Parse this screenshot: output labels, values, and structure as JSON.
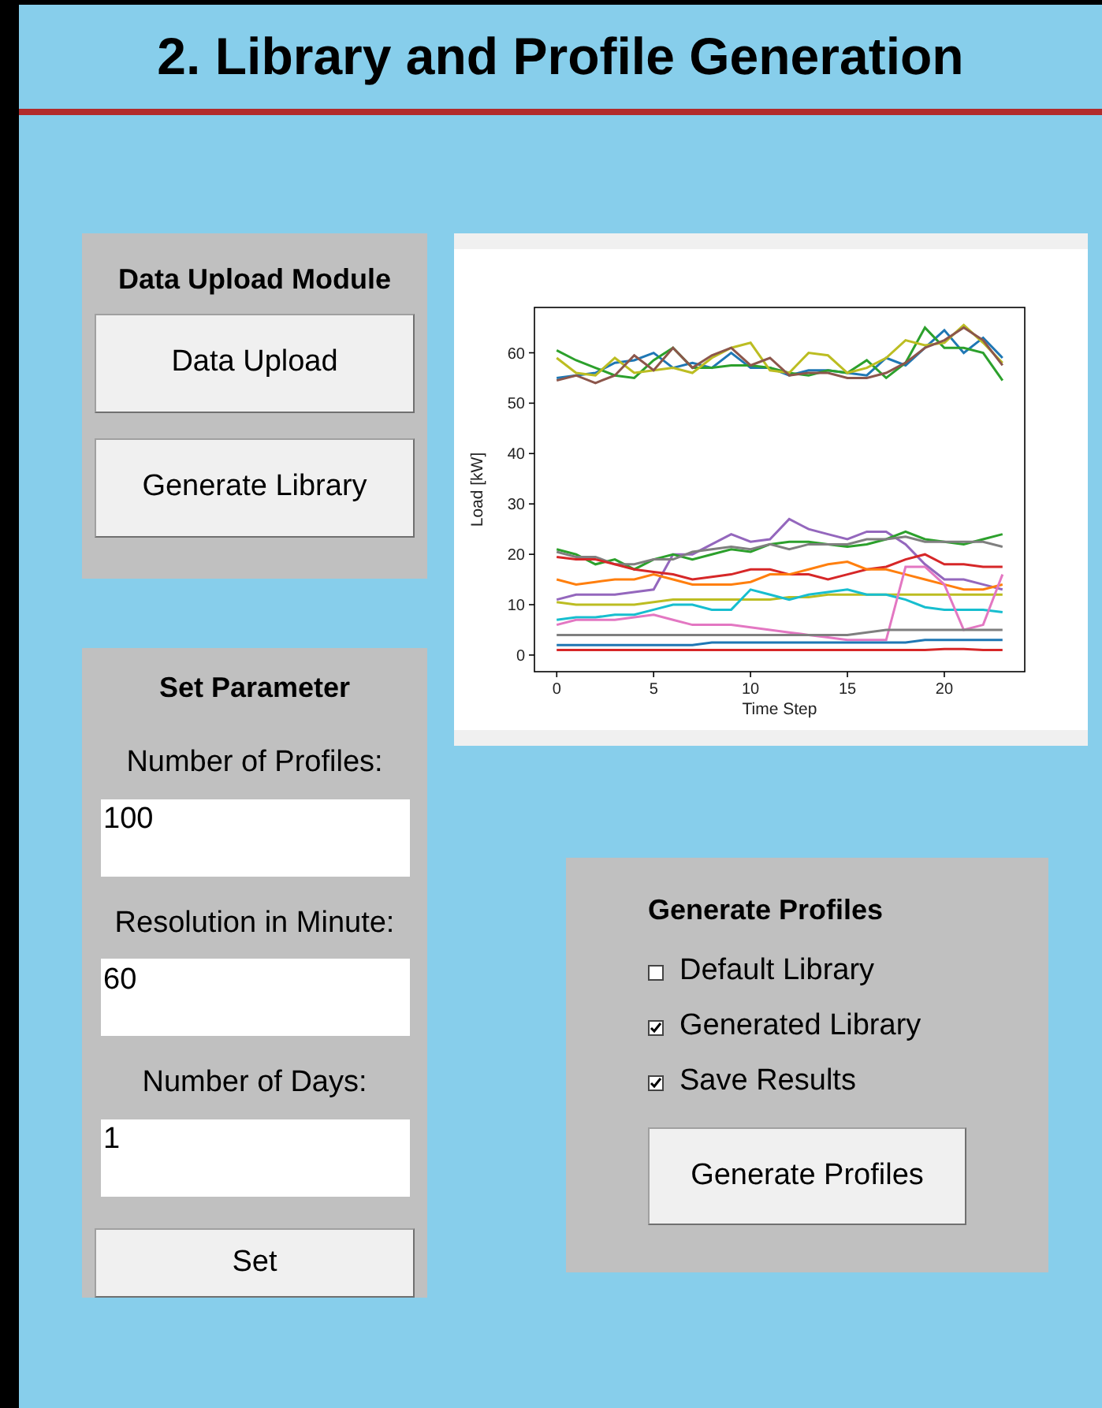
{
  "window": {
    "title": "2. Library and Profile Generation"
  },
  "upload_panel": {
    "title": "Data Upload Module",
    "buttons": [
      "Data Upload",
      "Generate Library"
    ]
  },
  "parameter_panel": {
    "title": "Set Parameter",
    "fields": [
      {
        "label": "Number of Profiles:",
        "value": "100"
      },
      {
        "label": "Resolution in Minute:",
        "value": "60"
      },
      {
        "label": "Number of Days:",
        "value": "1"
      }
    ],
    "button": "Set"
  },
  "chart": {
    "chart_data": {
      "type": "line",
      "xlabel": "Time Step",
      "ylabel": "Load [kW]",
      "xlim": [
        -1.15,
        24.15
      ],
      "ylim": [
        -3.3,
        69
      ],
      "xticks": [
        0,
        5,
        10,
        15,
        20
      ],
      "yticks": [
        0,
        10,
        20,
        30,
        40,
        50,
        60
      ],
      "x": [
        0,
        1,
        2,
        3,
        4,
        5,
        6,
        7,
        8,
        9,
        10,
        11,
        12,
        13,
        14,
        15,
        16,
        17,
        18,
        19,
        20,
        21,
        22,
        23
      ],
      "series": [
        {
          "color": "#1f77b4",
          "values": [
            55,
            55.5,
            56,
            58,
            58.5,
            60,
            57,
            58,
            57,
            60,
            57,
            57,
            55.5,
            56.5,
            56.5,
            56,
            55.5,
            59,
            57.5,
            61,
            64.5,
            60,
            63,
            59
          ]
        },
        {
          "color": "#2ca02c",
          "values": [
            60.5,
            58.5,
            57,
            55.5,
            55,
            58.5,
            61,
            57,
            57,
            57.5,
            57.5,
            57,
            56,
            55.5,
            56.5,
            56,
            58.5,
            55,
            58,
            65,
            61,
            61,
            60,
            54.5
          ]
        },
        {
          "color": "#bcbd22",
          "values": [
            59,
            56,
            55.5,
            59,
            56,
            56.5,
            57,
            56,
            59,
            61,
            62,
            56.5,
            56,
            60,
            59.5,
            56,
            57,
            59,
            62.5,
            61.5,
            62,
            65.5,
            62,
            58
          ]
        },
        {
          "color": "#8c564b",
          "values": [
            54.5,
            55.5,
            54,
            55.5,
            59.5,
            56.5,
            61,
            57,
            59.5,
            61,
            57.5,
            59,
            55.5,
            56,
            56,
            55,
            55,
            56,
            58,
            61,
            62.5,
            65,
            62.5,
            57.5
          ]
        },
        {
          "color": "#9467bd",
          "values": [
            11,
            12,
            12,
            12,
            12.5,
            13,
            20,
            20,
            22,
            24,
            22.5,
            23,
            27,
            25,
            24,
            23,
            24.5,
            24.5,
            22,
            18,
            15,
            15,
            14,
            13
          ]
        },
        {
          "color": "#2ca02c",
          "values": [
            21,
            20,
            18,
            19,
            17,
            19,
            20,
            19,
            20,
            21,
            20.5,
            22,
            22.5,
            22.5,
            22,
            21.5,
            22,
            23,
            24.5,
            23,
            22.5,
            22,
            23,
            24
          ]
        },
        {
          "color": "#7f7f7f",
          "values": [
            20.5,
            19.5,
            19.5,
            18,
            18,
            19,
            19,
            20.5,
            21,
            21.5,
            21,
            22,
            21,
            22,
            22,
            22,
            23,
            23,
            23.5,
            22.5,
            22.5,
            22.5,
            22.5,
            21.5
          ]
        },
        {
          "color": "#d62728",
          "values": [
            19.5,
            19,
            19,
            18,
            17,
            16.5,
            16,
            15,
            15.5,
            16,
            17,
            17,
            16,
            16,
            15,
            16,
            17,
            17.5,
            19,
            20,
            18,
            18,
            17.5,
            17.5
          ]
        },
        {
          "color": "#ff7f0e",
          "values": [
            15,
            14,
            14.5,
            15,
            15,
            16,
            15,
            14,
            14,
            14,
            14.5,
            16,
            16,
            17,
            18,
            18.5,
            17,
            17,
            16,
            15,
            14,
            13,
            13,
            14
          ]
        },
        {
          "color": "#bcbd22",
          "values": [
            10.5,
            10,
            10,
            10,
            10,
            10.5,
            11,
            11,
            11,
            11,
            11,
            11,
            11.5,
            11.5,
            12,
            12,
            12,
            12,
            12,
            12,
            12,
            12,
            12,
            12
          ]
        },
        {
          "color": "#17becf",
          "values": [
            7,
            7.5,
            7.5,
            8,
            8,
            9,
            10,
            10,
            9,
            9,
            13,
            12,
            11,
            12,
            12.5,
            13,
            12,
            12,
            11,
            9.5,
            9,
            9,
            9,
            8.5
          ]
        },
        {
          "color": "#e377c2",
          "values": [
            6,
            7,
            7,
            7,
            7.5,
            8,
            7,
            6,
            6,
            6,
            5.5,
            5,
            4.5,
            4,
            3.5,
            3,
            3,
            3,
            17.5,
            17.5,
            14,
            5,
            6,
            16
          ]
        },
        {
          "color": "#7f7f7f",
          "values": [
            4,
            4,
            4,
            4,
            4,
            4,
            4,
            4,
            4,
            4,
            4,
            4,
            4,
            4,
            4,
            4,
            4.5,
            5,
            5,
            5,
            5,
            5,
            5,
            5
          ]
        },
        {
          "color": "#1f77b4",
          "values": [
            2,
            2,
            2,
            2,
            2,
            2,
            2,
            2,
            2.5,
            2.5,
            2.5,
            2.5,
            2.5,
            2.5,
            2.5,
            2.5,
            2.5,
            2.5,
            2.5,
            3,
            3,
            3,
            3,
            3
          ]
        },
        {
          "color": "#d62728",
          "values": [
            1,
            1,
            1,
            1,
            1,
            1,
            1,
            1,
            1,
            1,
            1,
            1,
            1,
            1,
            1,
            1,
            1,
            1,
            1,
            1,
            1.2,
            1.2,
            1,
            1
          ]
        }
      ]
    }
  },
  "generate_panel": {
    "title": "Generate Profiles",
    "options": [
      {
        "label": "Default Library",
        "checked": false
      },
      {
        "label": "Generated Library",
        "checked": true
      },
      {
        "label": "Save Results",
        "checked": true
      }
    ],
    "button": "Generate Profiles"
  }
}
